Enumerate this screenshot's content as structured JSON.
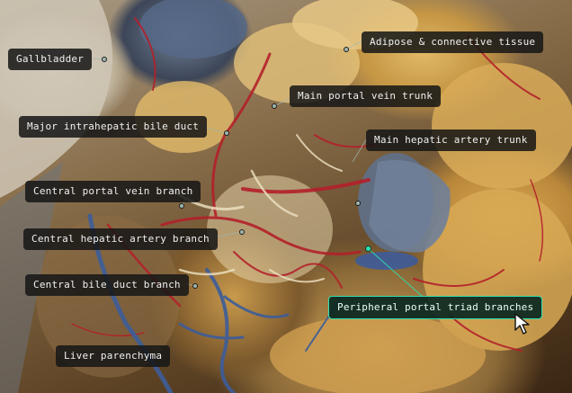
{
  "labels": {
    "gallbladder": "Gallbladder",
    "adipose": "Adipose & connective tissue",
    "main_portal_vein": "Main portal vein trunk",
    "major_bile_duct": "Major intrahepatic bile duct",
    "main_hepatic_artery": "Main hepatic artery trunk",
    "central_portal_vein": "Central portal vein branch",
    "central_hepatic_artery": "Central hepatic artery branch",
    "central_bile_duct": "Central bile duct branch",
    "peripheral_triad": "Peripheral portal triad branches",
    "liver_parenchyma": "Liver parenchyma"
  },
  "active_label": "peripheral_triad",
  "colors": {
    "label_bg": "#161616",
    "label_text": "#f1f1f1",
    "highlight": "#2fe0b0",
    "vessel_red": "#b3202a",
    "vessel_blue": "#3d5d9a"
  },
  "icons": [
    "pointer-cursor-icon"
  ]
}
